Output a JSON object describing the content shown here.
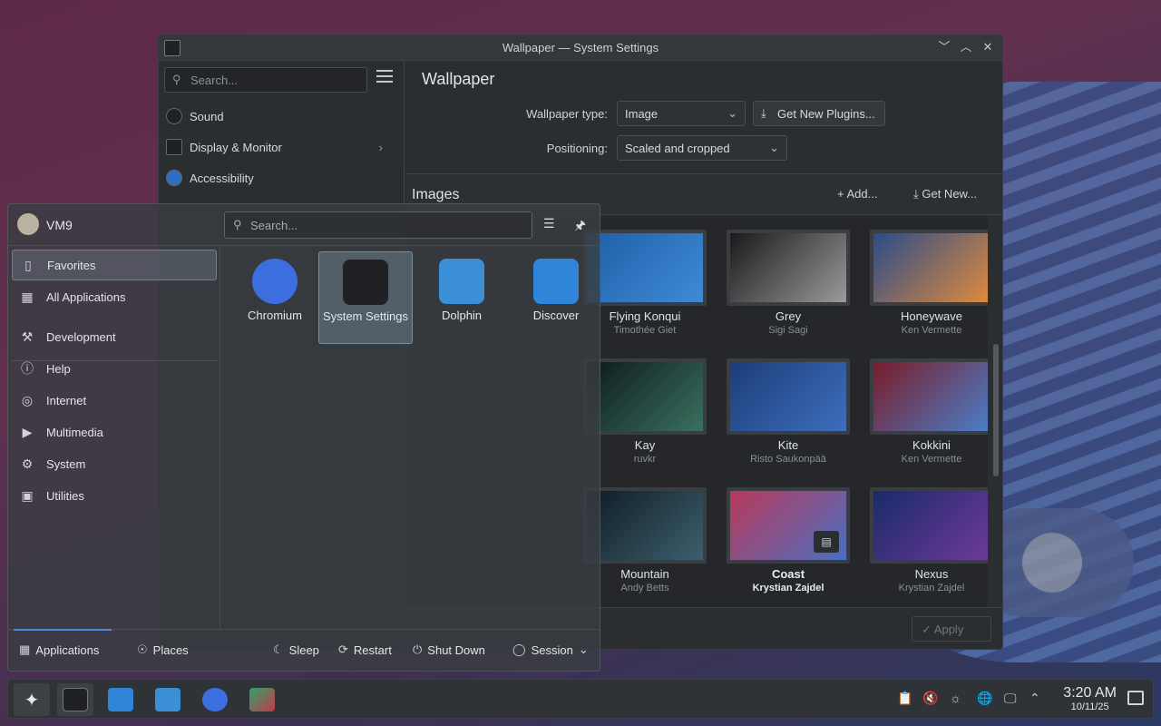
{
  "window": {
    "title": "Wallpaper — System Settings",
    "controls": [
      "﹀",
      "︿",
      "✕"
    ]
  },
  "sidebar": {
    "search_placeholder": "Search...",
    "items": [
      {
        "label": "Sound",
        "icon": "speaker-icon"
      },
      {
        "label": "Display & Monitor",
        "icon": "monitor-icon"
      },
      {
        "label": "Accessibility",
        "icon": "accessibility-icon"
      }
    ]
  },
  "page": {
    "title": "Wallpaper",
    "wallpaper_type_label": "Wallpaper type:",
    "wallpaper_type_value": "Image",
    "get_plugins_label": "Get New Plugins...",
    "positioning_label": "Positioning:",
    "positioning_value": "Scaled and cropped",
    "images_heading": "Images",
    "add_label": "Add...",
    "get_new_label": "Get New...",
    "apply_label": "Apply"
  },
  "wallpapers": [
    {
      "name": "Flying Konqui",
      "author": "Timothée Giet",
      "colors": [
        "#1f5fa8",
        "#3f8ad6"
      ]
    },
    {
      "name": "Grey",
      "author": "Sigi Sagi",
      "colors": [
        "#1a1a1a",
        "#9a9a9a"
      ]
    },
    {
      "name": "Honeywave",
      "author": "Ken Vermette",
      "colors": [
        "#2a4c8a",
        "#e08a3c"
      ]
    },
    {
      "name": "Kay",
      "author": "ruvkr",
      "colors": [
        "#0d1a1a",
        "#3a7060"
      ]
    },
    {
      "name": "Kite",
      "author": "Risto Saukonpää",
      "colors": [
        "#1d3d7a",
        "#3d6fbc"
      ]
    },
    {
      "name": "Kokkini",
      "author": "Ken Vermette",
      "colors": [
        "#7a1c2a",
        "#4a7ec8"
      ]
    },
    {
      "name": "Mountain",
      "author": "Andy Betts",
      "colors": [
        "#0e1b24",
        "#3e5f6e"
      ]
    },
    {
      "name": "Coast",
      "author": "Krystian Zajdel",
      "colors": [
        "#b83a5a",
        "#4a6fc0"
      ],
      "selected": true
    },
    {
      "name": "Nexus",
      "author": "Krystian Zajdel",
      "colors": [
        "#1a2a6a",
        "#6e3a9a"
      ]
    }
  ],
  "launcher": {
    "user": "VM9",
    "search_placeholder": "Search...",
    "categories": [
      {
        "label": "Favorites",
        "icon": "bookmark-icon",
        "active": true
      },
      {
        "label": "All Applications",
        "icon": "grid-icon"
      },
      {
        "label": "Development",
        "icon": "hammer-icon"
      },
      {
        "label": "Help",
        "icon": "info-icon"
      },
      {
        "label": "Internet",
        "icon": "globe-icon"
      },
      {
        "label": "Multimedia",
        "icon": "multimedia-icon"
      },
      {
        "label": "System",
        "icon": "gear-icon"
      },
      {
        "label": "Utilities",
        "icon": "toolbox-icon"
      }
    ],
    "apps": [
      {
        "label": "Chromium",
        "color": "#3d6ee0"
      },
      {
        "label": "System Settings",
        "color": "#1f2124",
        "selected": true
      },
      {
        "label": "Dolphin",
        "color": "#3a8fd6"
      },
      {
        "label": "Discover",
        "color": "#2f86d9"
      }
    ],
    "footer": {
      "applications": "Applications",
      "places": "Places",
      "sleep": "Sleep",
      "restart": "Restart",
      "shutdown": "Shut Down",
      "session": "Session"
    }
  },
  "taskbar": {
    "time": "3:20 AM",
    "date": "10/11/25"
  }
}
